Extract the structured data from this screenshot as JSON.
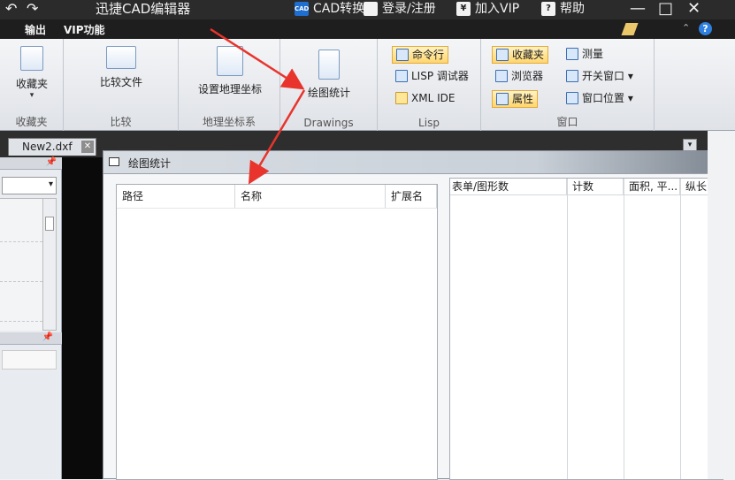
{
  "titlebar": {
    "title": "迅捷CAD编辑器",
    "cad_convert": "CAD转换",
    "login": "登录/注册",
    "vip": "加入VIP",
    "help": "帮助",
    "cad_icon_text": "CAD",
    "yen_icon_text": "¥",
    "help_icon_text": "?",
    "minimize": "—",
    "maximize": "□",
    "close": "✕",
    "undo_glyph": "↶",
    "redo_glyph": "↷"
  },
  "menubar": {
    "output": "输出",
    "vip_features": "VIP功能"
  },
  "ribbon": {
    "groups": {
      "favorites": {
        "button": "收藏夹",
        "label": "收藏夹"
      },
      "compare": {
        "button": "比较文件",
        "label": "比较"
      },
      "geo": {
        "button": "设置地理坐标",
        "label": "地理坐标系"
      },
      "drawings": {
        "button": "绘图统计",
        "label": "Drawings"
      },
      "lisp": {
        "cmd": "命令行",
        "debugger": "LISP 调试器",
        "xml": "XML IDE",
        "label": "Lisp"
      },
      "window": {
        "favorites": "收藏夹",
        "measure": "测量",
        "browser": "浏览器",
        "switch": "开关窗口",
        "properties": "属性",
        "position": "窗口位置",
        "label": "窗口"
      }
    }
  },
  "tabs": {
    "doc": "New2.dxf",
    "close": "✕"
  },
  "panel": {
    "pin1": "ꟷ",
    "pin2": "ꟷ"
  },
  "dialog": {
    "title": "绘图统计",
    "left_columns": [
      "路径",
      "名称",
      "扩展名"
    ],
    "right_columns": [
      "表单/图形数",
      "计数",
      "面积, 平...",
      "纵长 ..."
    ]
  },
  "colors": {
    "title_bg": "#2b2b2b",
    "ribbon_bg": "#e4e7eb",
    "active_btn": "#ffd66e",
    "arrow": "#e8342c"
  }
}
